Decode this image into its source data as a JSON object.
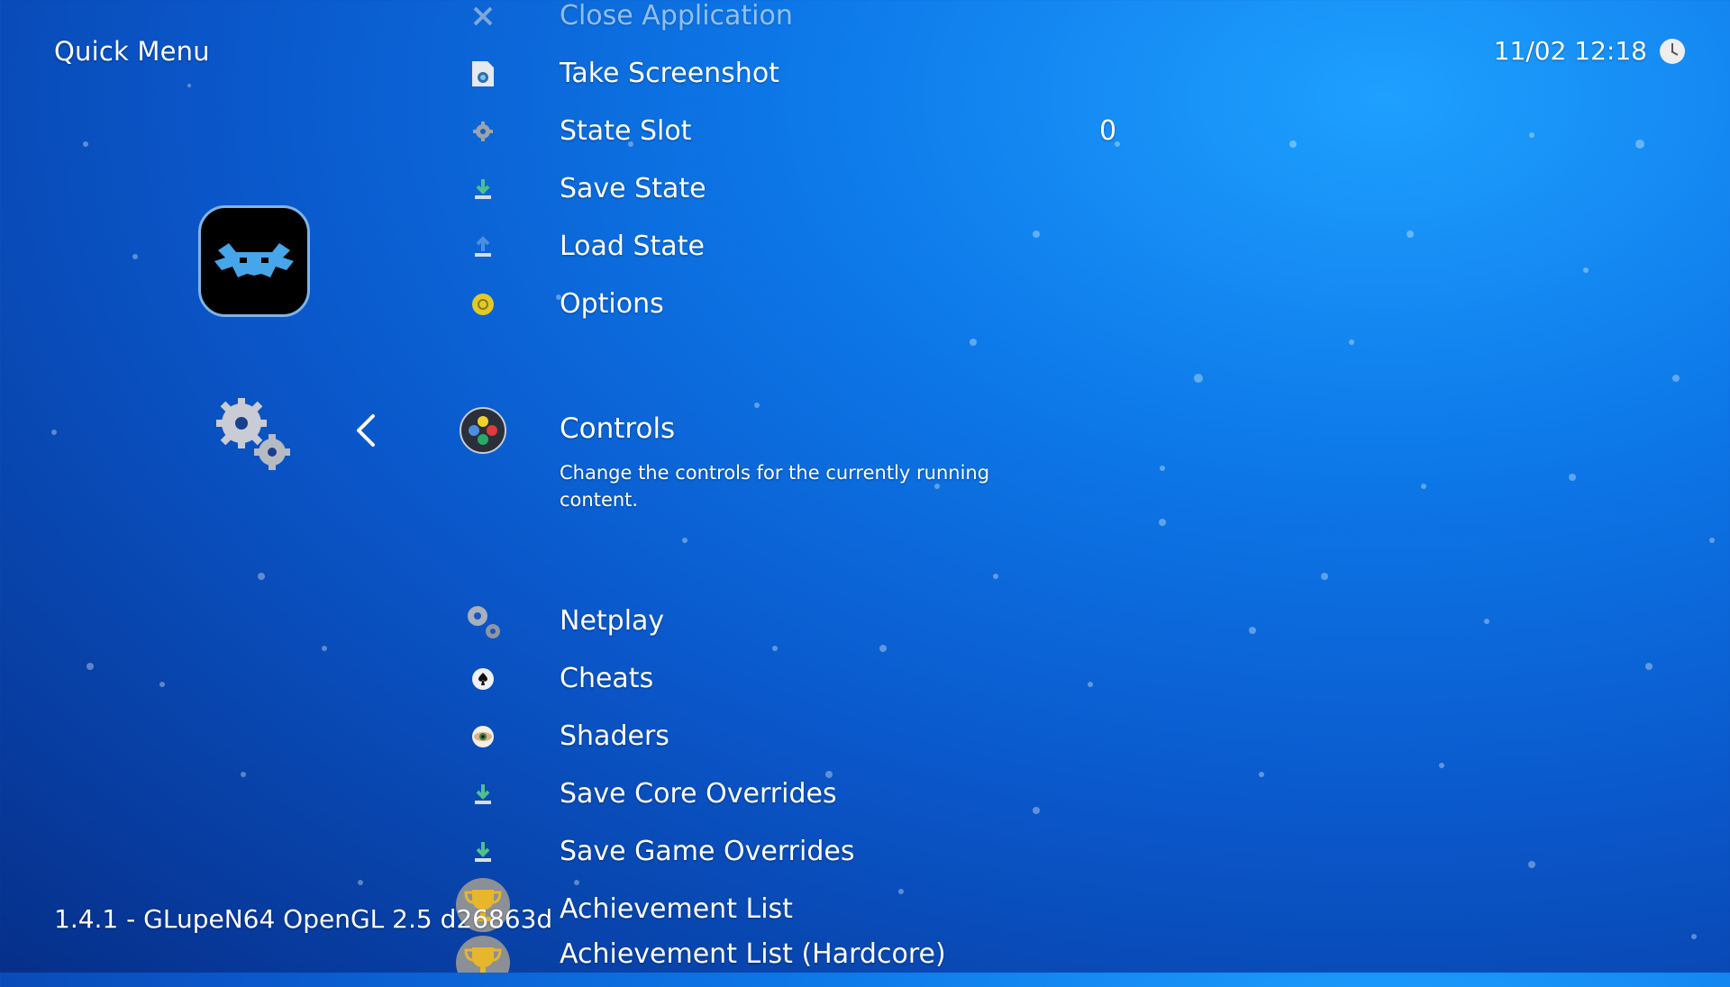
{
  "header": {
    "title": "Quick Menu"
  },
  "clock": {
    "datetime": "11/02 12:18",
    "icon": "clock-icon"
  },
  "sidebar": {
    "logo_icon": "retroarch-invader-icon",
    "settings_icon": "gears-icon",
    "back_icon": "chevron-left-icon"
  },
  "menu": {
    "items": [
      {
        "label": "Close Application",
        "icon": "close-icon"
      },
      {
        "label": "Take Screenshot",
        "icon": "screenshot-icon"
      },
      {
        "label": "State Slot",
        "icon": "gear-icon",
        "value": "0"
      },
      {
        "label": "Save State",
        "icon": "save-state-icon"
      },
      {
        "label": "Load State",
        "icon": "load-state-icon"
      },
      {
        "label": "Options",
        "icon": "options-icon"
      },
      {
        "label": "Controls",
        "icon": "gamepad-icon",
        "sublabel": "Change the controls for the currently running content.",
        "selected": true
      },
      {
        "label": "Netplay",
        "icon": "netplay-gears-icon"
      },
      {
        "label": "Cheats",
        "icon": "cheats-spade-icon"
      },
      {
        "label": "Shaders",
        "icon": "shaders-eye-icon"
      },
      {
        "label": "Save Core Overrides",
        "icon": "save-core-overrides-icon"
      },
      {
        "label": "Save Game Overrides",
        "icon": "save-game-overrides-icon"
      },
      {
        "label": "Achievement List",
        "icon": "trophy-icon"
      },
      {
        "label": "Achievement List (Hardcore)",
        "icon": "trophy-icon"
      }
    ]
  },
  "footer": {
    "version": "1.4.1 - GLupeN64 OpenGL 2.5 d26863d"
  },
  "colors": {
    "accent": "#0d78e8",
    "background_dark": "#062f8a"
  }
}
